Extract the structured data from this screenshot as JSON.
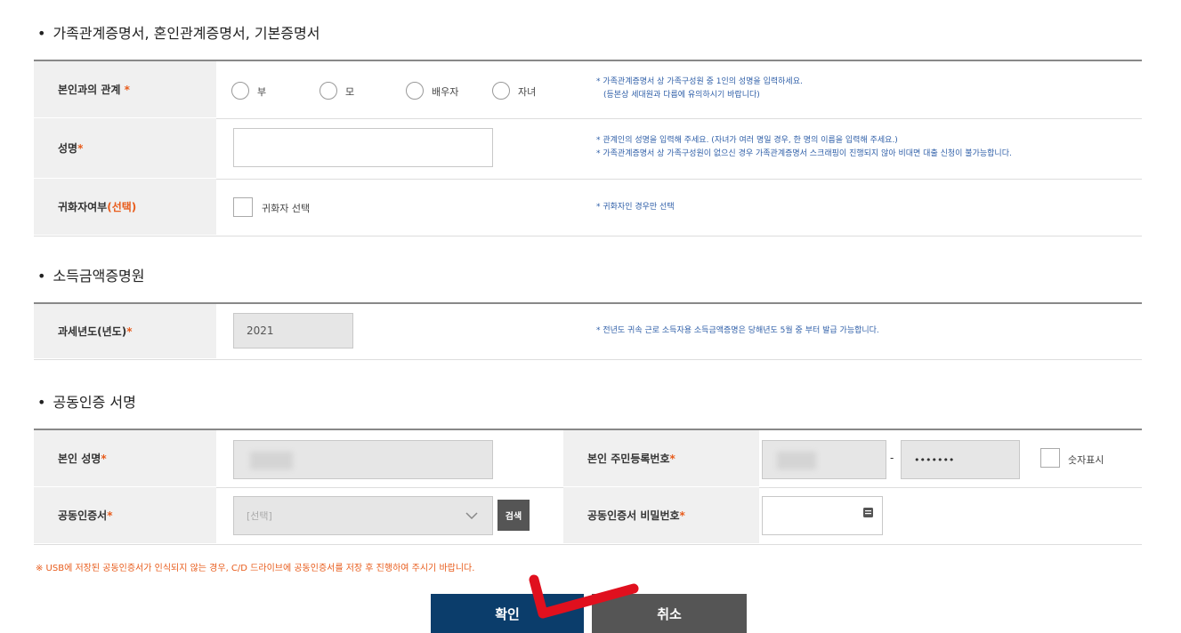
{
  "sections": {
    "family": "가족관계증명서, 혼인관계증명서, 기본증명서",
    "income": "소득금액증명원",
    "sign": "공동인증 서명"
  },
  "family_form": {
    "relation_label": "본인과의 관계",
    "relation_options": [
      "부",
      "모",
      "배우자",
      "자녀"
    ],
    "relation_note_1": "* 가족관계증명서 상 가족구성원 중 1인의 성명을 입력하세요.",
    "relation_note_2": "(등본상 세대원과 다름에 유의하시기 바랍니다)",
    "name_label": "성명",
    "name_value": "",
    "name_note_1": "* 관계인의 성명을 입력해 주세요. (자녀가 여러 명일 경우, 한 명의 이름을 입력해 주세요.)",
    "name_note_2": "* 가족관계증명서 상 가족구성원이 없으신 경우 가족관계증명서 스크래핑이 진행되지 않아 비대면 대출 신청이 불가능합니다.",
    "naturalized_label": "귀화자여부",
    "naturalized_optional": "(선택)",
    "naturalized_checkbox": "귀화자 선택",
    "naturalized_note": "* 귀화자인 경우만 선택"
  },
  "income_form": {
    "year_label": "과세년도(년도)",
    "year_value": "2021",
    "year_note": "* 전년도 귀속 근로 소득자용 소득금액증명은 당해년도 5월 중 부터 발급 가능합니다."
  },
  "sign_form": {
    "my_name_label": "본인 성명",
    "rrn_label": "본인 주민등록번호",
    "rrn_dash": "-",
    "rrn_back_value": "•••••••",
    "show_digits_label": "숫자표시",
    "cert_label": "공동인증서",
    "cert_select_value": "[선택]",
    "search_button": "검색",
    "cert_pw_label": "공동인증서 비밀번호"
  },
  "required_mark": "*",
  "warning": "※ USB에 저장된 공동인증서가 인식되지 않는 경우, C/D 드라이브에 공동인증서를 저장 후 진행하여 주시기 바랍니다.",
  "buttons": {
    "confirm": "확인",
    "cancel": "취소"
  },
  "colors": {
    "primary": "#0b3d6b",
    "secondary": "#555555",
    "required": "#e85c1c",
    "note": "#2f5fa8",
    "annotation": "#e0101e"
  }
}
